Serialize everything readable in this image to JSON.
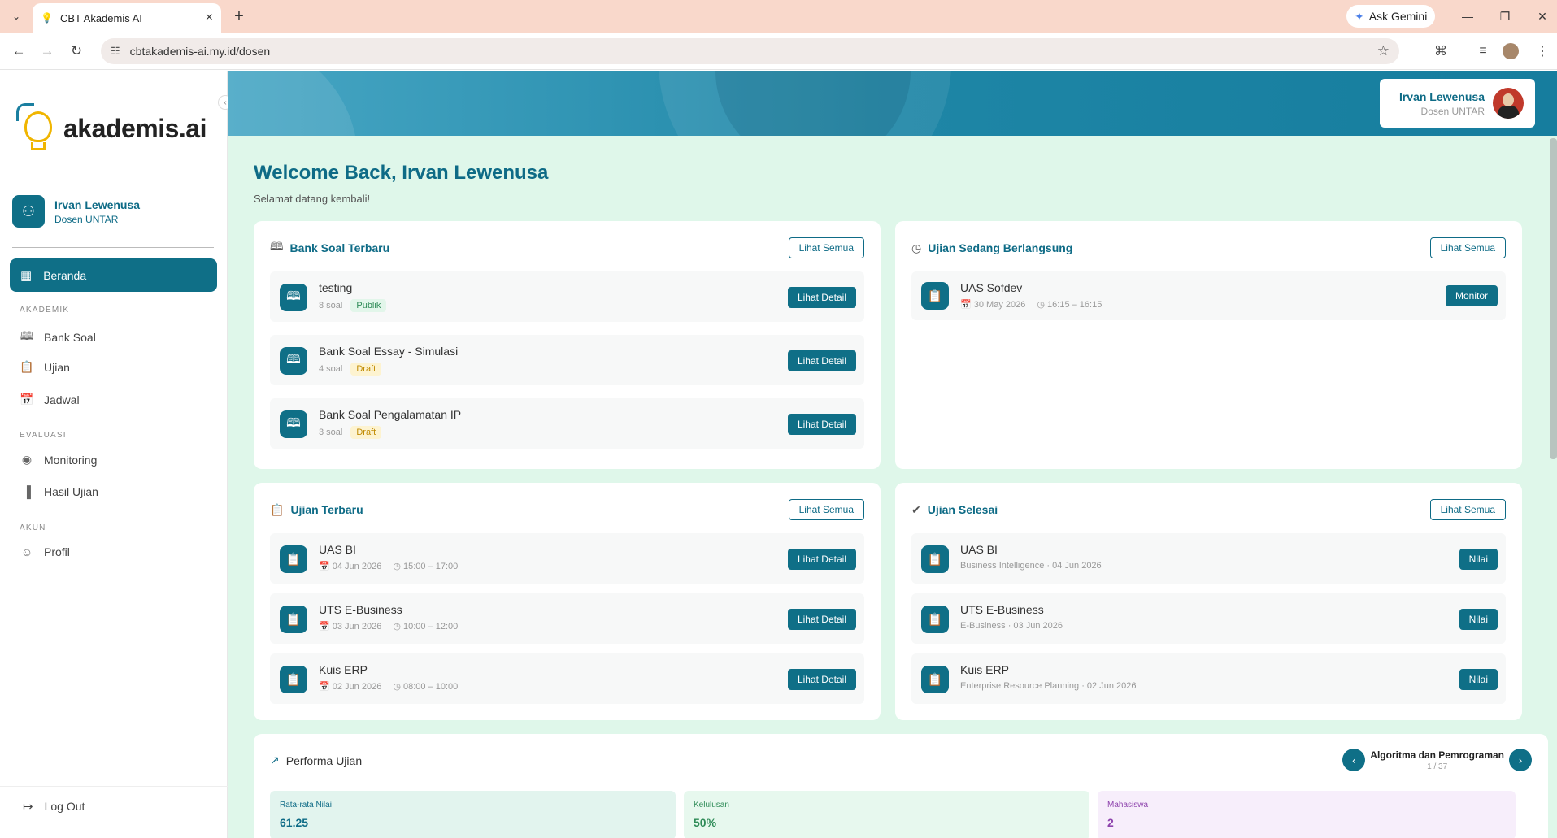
{
  "browser": {
    "tab_title": "CBT Akademis AI",
    "url": "cbtakademis-ai.my.id/dosen",
    "ask_gemini": "Ask Gemini"
  },
  "sidebar": {
    "logo_text": "akademis.ai",
    "user_name": "Irvan Lewenusa",
    "user_role": "Dosen UNTAR",
    "active_item": "Beranda",
    "section_akademik": "AKADEMIK",
    "section_evaluasi": "EVALUASI",
    "section_akun": "AKUN",
    "items": {
      "bank_soal": "Bank Soal",
      "ujian": "Ujian",
      "jadwal": "Jadwal",
      "monitoring": "Monitoring",
      "hasil_ujian": "Hasil Ujian",
      "profil": "Profil"
    },
    "logout": "Log Out"
  },
  "header": {
    "user_name": "Irvan Lewenusa",
    "user_role": "Dosen UNTAR"
  },
  "welcome": {
    "title": "Welcome Back, Irvan Lewenusa",
    "subtitle": "Selamat datang kembali!"
  },
  "bank_soal_card": {
    "title": "Bank Soal Terbaru",
    "see_all": "Lihat Semua",
    "items": [
      {
        "title": "testing",
        "count": "8 soal",
        "status": "Publik",
        "button": "Lihat Detail"
      },
      {
        "title": "Bank Soal Essay - Simulasi",
        "count": "4 soal",
        "status": "Draft",
        "button": "Lihat Detail"
      },
      {
        "title": "Bank Soal Pengalamatan IP",
        "count": "3 soal",
        "status": "Draft",
        "button": "Lihat Detail"
      }
    ]
  },
  "ongoing_card": {
    "title": "Ujian Sedang Berlangsung",
    "see_all": "Lihat Semua",
    "items": [
      {
        "title": "UAS Sofdev",
        "date": "30 May 2026",
        "time": "16:15 – 16:15",
        "button": "Monitor"
      }
    ]
  },
  "recent_card": {
    "title": "Ujian Terbaru",
    "see_all": "Lihat Semua",
    "items": [
      {
        "title": "UAS BI",
        "date": "04 Jun 2026",
        "time": "15:00 – 17:00",
        "button": "Lihat Detail"
      },
      {
        "title": "UTS E-Business",
        "date": "03 Jun 2026",
        "time": "10:00 – 12:00",
        "button": "Lihat Detail"
      },
      {
        "title": "Kuis ERP",
        "date": "02 Jun 2026",
        "time": "08:00 – 10:00",
        "button": "Lihat Detail"
      }
    ]
  },
  "finished_card": {
    "title": "Ujian Selesai",
    "see_all": "Lihat Semua",
    "items": [
      {
        "title": "UAS BI",
        "meta": "Business Intelligence · 04 Jun 2026",
        "button": "Nilai"
      },
      {
        "title": "UTS E-Business",
        "meta": "E-Business · 03 Jun 2026",
        "button": "Nilai"
      },
      {
        "title": "Kuis ERP",
        "meta": "Enterprise Resource Planning · 02 Jun 2026",
        "button": "Nilai"
      }
    ]
  },
  "performance": {
    "title": "Performa Ujian",
    "course": "Algoritma dan Pemrograman",
    "counter": "1 / 37",
    "stats": {
      "avg_label": "Rata-rata Nilai",
      "avg_value": "61.25",
      "pass_label": "Kelulusan",
      "pass_value": "50%",
      "students_label": "Mahasiswa",
      "students_value": "2"
    }
  },
  "colors": {
    "primary": "#0f6f87",
    "background": "#dff7ea",
    "browser_bar": "#f9d8cb",
    "draft": "#c08a00",
    "publik": "#2e8b57",
    "mahasiswa": "#8e44ad"
  }
}
